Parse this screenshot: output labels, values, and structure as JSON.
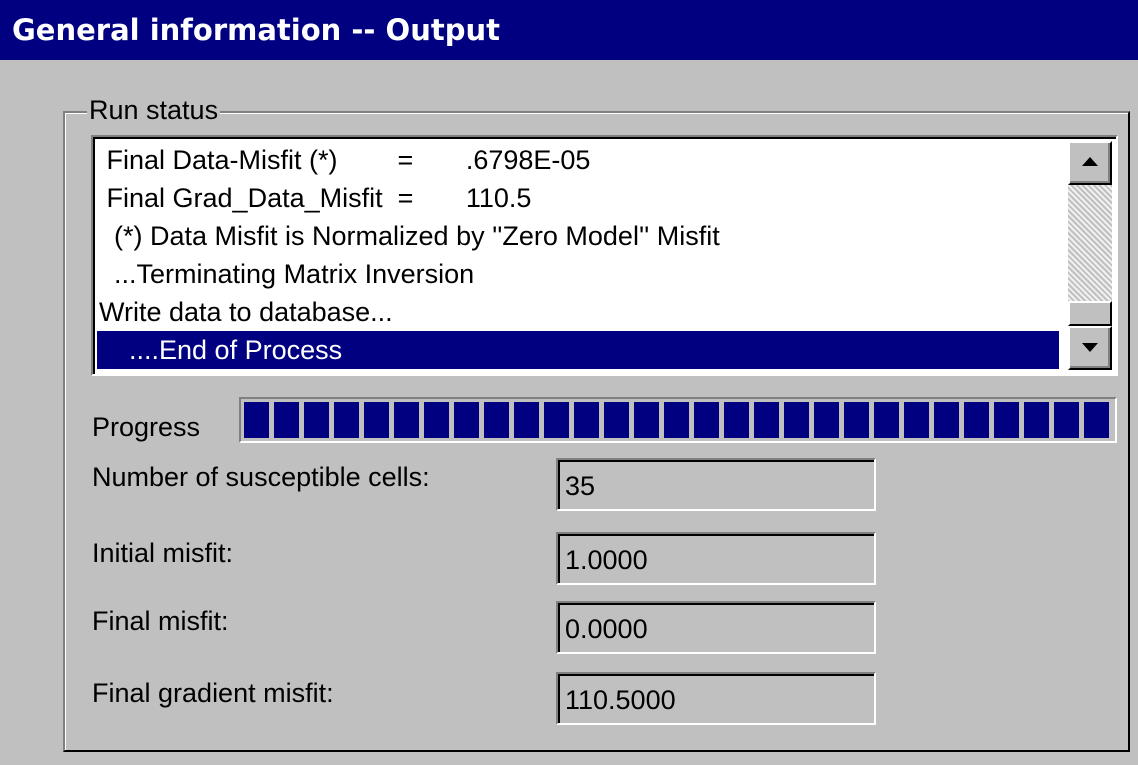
{
  "window": {
    "title": "General information -- Output"
  },
  "run_status": {
    "group_label": "Run status",
    "lines": [
      " Final Data-Misfit (*)        =       .6798E-05",
      " Final Grad_Data_Misfit  =       110.5",
      "  (*) Data Misfit is Normalized by ''Zero Model'' Misfit",
      "  ...Terminating Matrix Inversion",
      "Write data to database...",
      "    ....End of Process"
    ],
    "selected_index": 5
  },
  "progress": {
    "label": "Progress",
    "fraction": 1.0
  },
  "fields": {
    "susceptible_cells": {
      "label": "Number of susceptible cells:",
      "value": "35"
    },
    "initial_misfit": {
      "label": "Initial misfit:",
      "value": "1.0000"
    },
    "final_misfit": {
      "label": "Final misfit:",
      "value": "0.0000"
    },
    "final_gradient_misfit": {
      "label": "Final gradient misfit:",
      "value": "110.5000"
    }
  },
  "colors": {
    "title_bar": "#000080",
    "face": "#c0c0c0",
    "selection": "#000080",
    "progress_block": "#000080"
  },
  "icons": {
    "scroll_up": "arrow-up-icon",
    "scroll_down": "arrow-down-icon"
  }
}
